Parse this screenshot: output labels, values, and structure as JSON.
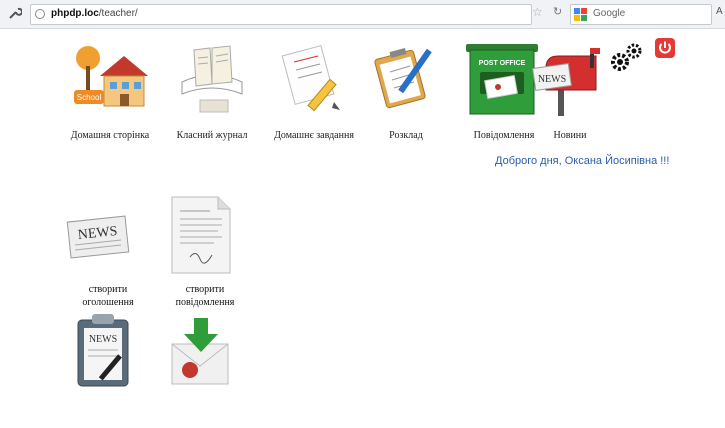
{
  "browser": {
    "url_host": "phpdp.loc",
    "url_path": "/teacher/",
    "search_placeholder": "Google",
    "right_letter": "A"
  },
  "nav": [
    {
      "label": "Домашня сторінка",
      "icon": "school-icon"
    },
    {
      "label": "Класний журнал",
      "icon": "journal-icon"
    },
    {
      "label": "Домашнє завдання",
      "icon": "homework-icon"
    },
    {
      "label": "Розклад",
      "icon": "schedule-icon"
    },
    {
      "label": "Повідомлення",
      "icon": "post-office-icon"
    },
    {
      "label": "Новини",
      "icon": "mailbox-news-icon"
    }
  ],
  "post_office_text": "POST OFFICE",
  "mailbox_sign": "NEWS",
  "school_sign": "School",
  "greeting": "Доброго дня, Оксана Йосипівна !!!",
  "tiles": [
    {
      "label_line1": "створити",
      "label_line2": "оголошення",
      "icon_text": "NEWS"
    },
    {
      "label_line1": "створити",
      "label_line2": "повідомлення"
    },
    {
      "icon_text": "NEWS"
    },
    {}
  ],
  "colors": {
    "link": "#2a5db0",
    "power": "#e53935",
    "post_green": "#2e9d3a"
  }
}
